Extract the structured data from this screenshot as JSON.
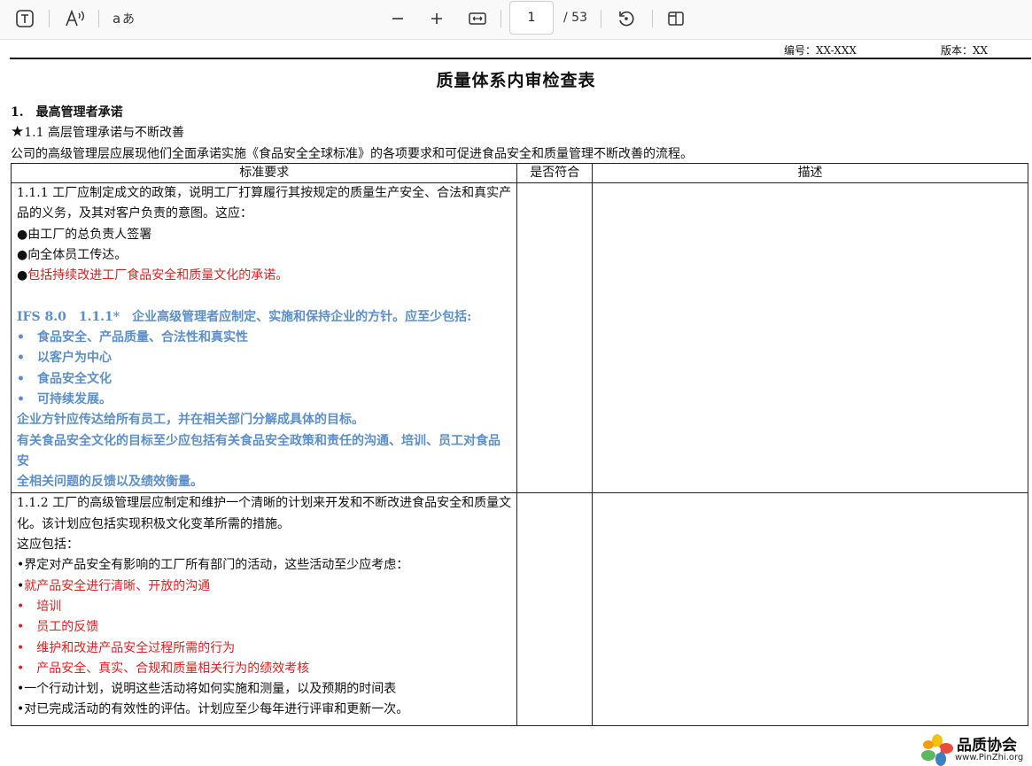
{
  "toolbar": {
    "current_page": "1",
    "total_pages": "/ 53",
    "icons": [
      "text-box-icon",
      "read-aloud-icon",
      "translate-icon",
      "zoom-out-icon",
      "zoom-in-icon",
      "fit-width-icon",
      "rotate-icon",
      "page-view-icon"
    ]
  },
  "document": {
    "doc_code": "编号：XX-XXX",
    "version": "版本：XX",
    "title": "质量体系内审检查表",
    "section_1": "1.　最高管理者承诺",
    "section_1_1_star": "★",
    "section_1_1": "1.1 高层管理承诺与不断改善",
    "intro": "公司的高级管理层应展现他们全面承诺实施《食品安全全球标准》的各项要求和可促进食品安全和质量管理不断改善的流程。",
    "table": {
      "headers": [
        "标准要求",
        "是否符合",
        "描述"
      ],
      "row1": [
        {
          "text": "1.1.1 工厂应制定成文的政策，说明工厂打算履行其按规定的质量生产安全、合法和真实产品的义务，及其对客户负责的意图。这应：",
          "style": ""
        },
        {
          "text": "●由工厂的总负责人签署",
          "style": ""
        },
        {
          "text": "●向全体员工传达。",
          "style": ""
        },
        {
          "prefix": "●",
          "text": "包括持续改进工厂食品安全和质量文化的承诺。",
          "style": "red"
        },
        {
          "text": "",
          "style": "blank"
        },
        {
          "text": "IFS 8.0　1.1.1*　企业高级管理者应制定、实施和保持企业的方针。应至少包括:",
          "style": "blue"
        },
        {
          "text": "•　食品安全、产品质量、合法性和真实性",
          "style": "blue"
        },
        {
          "text": "•　以客户为中心",
          "style": "blue"
        },
        {
          "text": "•　食品安全文化",
          "style": "blue"
        },
        {
          "text": "•　可持续发展。",
          "style": "blue"
        },
        {
          "text": "企业方针应传达给所有员工，并在相关部门分解成具体的目标。",
          "style": "blue"
        },
        {
          "text": "有关食品安全文化的目标至少应包括有关食品安全政策和责任的沟通、培训、员工对食品安",
          "style": "blue"
        },
        {
          "text": "全相关问题的反馈以及绩效衡量。",
          "style": "blue"
        }
      ],
      "row2": [
        {
          "text": "1.1.2 工厂的高级管理层应制定和维护一个清晰的计划来开发和不断改进食品安全和质量文化。该计划应包括实现积极文化变革所需的措施。",
          "style": ""
        },
        {
          "text": "这应包括：",
          "style": ""
        },
        {
          "text": "•界定对产品安全有影响的工厂所有部门的活动，这些活动至少应考虑：",
          "style": ""
        },
        {
          "prefix": "•",
          "text": "就产品安全进行清晰、开放的沟通",
          "style": "red"
        },
        {
          "text": "•　培训",
          "style": "red"
        },
        {
          "text": "•　员工的反馈",
          "style": "red"
        },
        {
          "text": "•　维护和改进产品安全过程所需的行为",
          "style": "red"
        },
        {
          "text": "•　产品安全、真实、合规和质量相关行为的绩效考核",
          "style": "red"
        },
        {
          "text": "•一个行动计划，说明这些活动将如何实施和测量，以及预期的时间表",
          "style": ""
        },
        {
          "text": "•对已完成活动的有效性的评估。计划应至少每年进行评审和更新一次。",
          "style": ""
        }
      ]
    }
  },
  "watermark": {
    "title": "品质协会",
    "subtitle": "www.PinZhi.org"
  }
}
